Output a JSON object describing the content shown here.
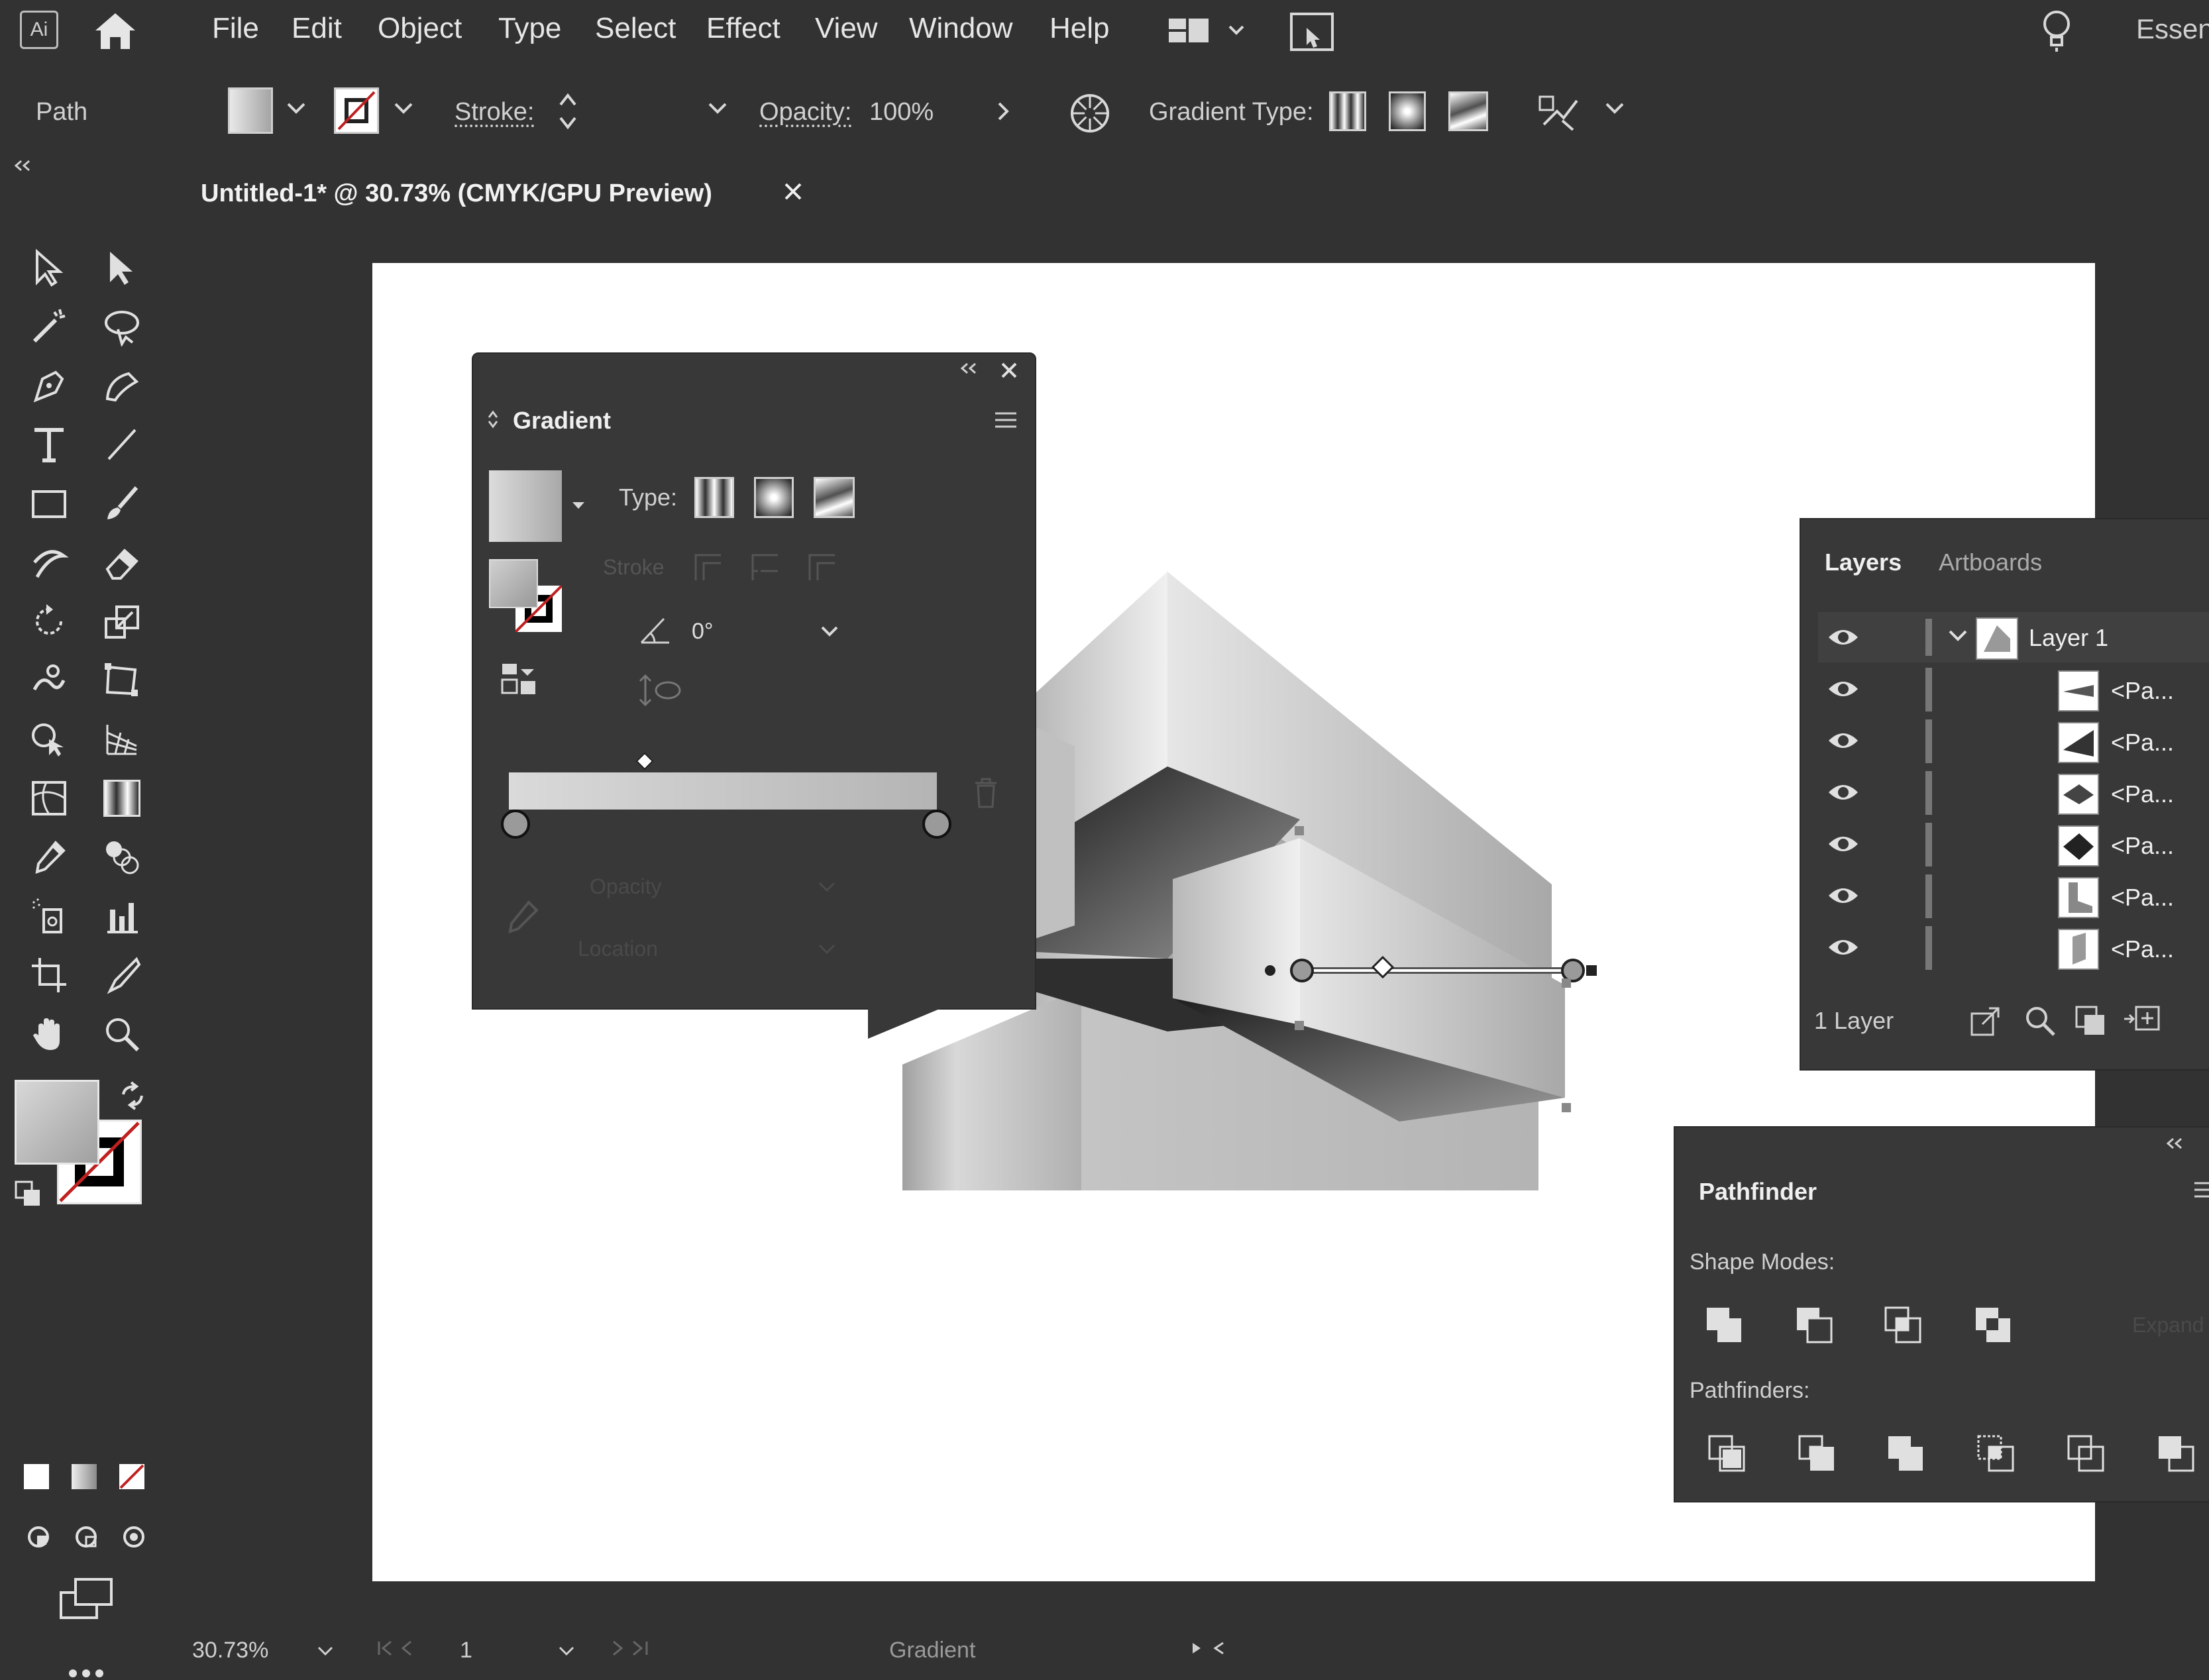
{
  "app": {
    "logo": "Ai",
    "workspace": "Essen"
  },
  "menu": [
    "File",
    "Edit",
    "Object",
    "Type",
    "Select",
    "Effect",
    "View",
    "Window",
    "Help"
  ],
  "control_bar": {
    "selection_kind": "Path",
    "stroke_label": "Stroke:",
    "opacity_label": "Opacity:",
    "opacity_value": "100%",
    "gradient_type_label": "Gradient Type:"
  },
  "document_tab": {
    "title": "Untitled-1* @ 30.73% (CMYK/GPU Preview)"
  },
  "gradient_panel": {
    "title": "Gradient",
    "type_label": "Type:",
    "stroke_label": "Stroke",
    "angle_value": "0°",
    "opacity_label": "Opacity",
    "location_label": "Location"
  },
  "layers_panel": {
    "tabs": [
      "Layers",
      "Artboards"
    ],
    "layer_name": "Layer 1",
    "sublayers": [
      "<Pa...",
      "<Pa...",
      "<Pa...",
      "<Pa...",
      "<Pa...",
      "<Pa..."
    ],
    "footer_count": "1 Layer"
  },
  "pathfinder_panel": {
    "title": "Pathfinder",
    "shape_modes_label": "Shape Modes:",
    "expand_label": "Expand",
    "pathfinders_label": "Pathfinders:"
  },
  "status_bar": {
    "zoom": "30.73%",
    "artboard_number": "1",
    "current_tool": "Gradient"
  },
  "colors": {
    "ui_bg": "#323232",
    "panel_bg": "#383838",
    "canvas": "#ffffff",
    "highlight_text": "#f2f2f2"
  },
  "icons": [
    "home-icon",
    "workspace-switcher-icon",
    "arrange-documents-icon",
    "lightbulb-icon",
    "selection-tool-icon",
    "direct-selection-tool-icon",
    "magic-wand-icon",
    "lasso-icon",
    "pen-tool-icon",
    "curvature-tool-icon",
    "type-tool-icon",
    "line-tool-icon",
    "rectangle-tool-icon",
    "paintbrush-icon",
    "shaper-icon",
    "eraser-icon",
    "rotate-icon",
    "scale-icon",
    "warp-icon",
    "free-transform-icon",
    "shape-builder-icon",
    "perspective-grid-icon",
    "mesh-icon",
    "gradient-tool-icon",
    "eyedropper-icon",
    "blend-icon",
    "symbol-sprayer-icon",
    "column-graph-icon",
    "artboard-tool-icon",
    "slice-icon",
    "hand-icon",
    "zoom-icon",
    "eye-icon",
    "trash-icon"
  ]
}
